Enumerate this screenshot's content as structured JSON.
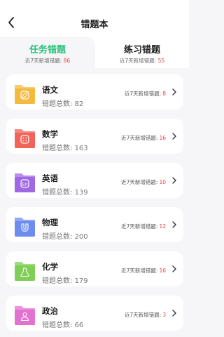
{
  "header": {
    "title": "错题本"
  },
  "tabs": [
    {
      "label": "任务错题",
      "recent_label": "近7天新增错题:",
      "recent_count": "86",
      "active": true
    },
    {
      "label": "练习错题",
      "recent_label": "近7天新增错题:",
      "recent_count": "55",
      "active": false
    }
  ],
  "subjects": [
    {
      "name": "语文",
      "total_label": "错题总数:",
      "total": "82",
      "recent_label": "近7天新增错题:",
      "recent": "8",
      "color": "#f5b93e",
      "icon": "leaf-icon"
    },
    {
      "name": "数学",
      "total_label": "错题总数:",
      "total": "163",
      "recent_label": "近7天新增错题:",
      "recent": "16",
      "color": "#f2645a",
      "icon": "calculator-icon"
    },
    {
      "name": "英语",
      "total_label": "错题总数:",
      "total": "139",
      "recent_label": "近7天新增错题:",
      "recent": "10",
      "color": "#a168e6",
      "icon": "english-icon"
    },
    {
      "name": "物理",
      "total_label": "错题总数:",
      "total": "200",
      "recent_label": "近7天新增错题:",
      "recent": "12",
      "color": "#6c8cf0",
      "icon": "magnet-icon"
    },
    {
      "name": "化学",
      "total_label": "错题总数:",
      "total": "179",
      "recent_label": "近7天新增错题:",
      "recent": "16",
      "color": "#7fcf56",
      "icon": "flask-icon"
    },
    {
      "name": "政治",
      "total_label": "错题总数:",
      "total": "66",
      "recent_label": "近7天新增错题:",
      "recent": "3",
      "color": "#e470d0",
      "icon": "person-icon"
    }
  ]
}
